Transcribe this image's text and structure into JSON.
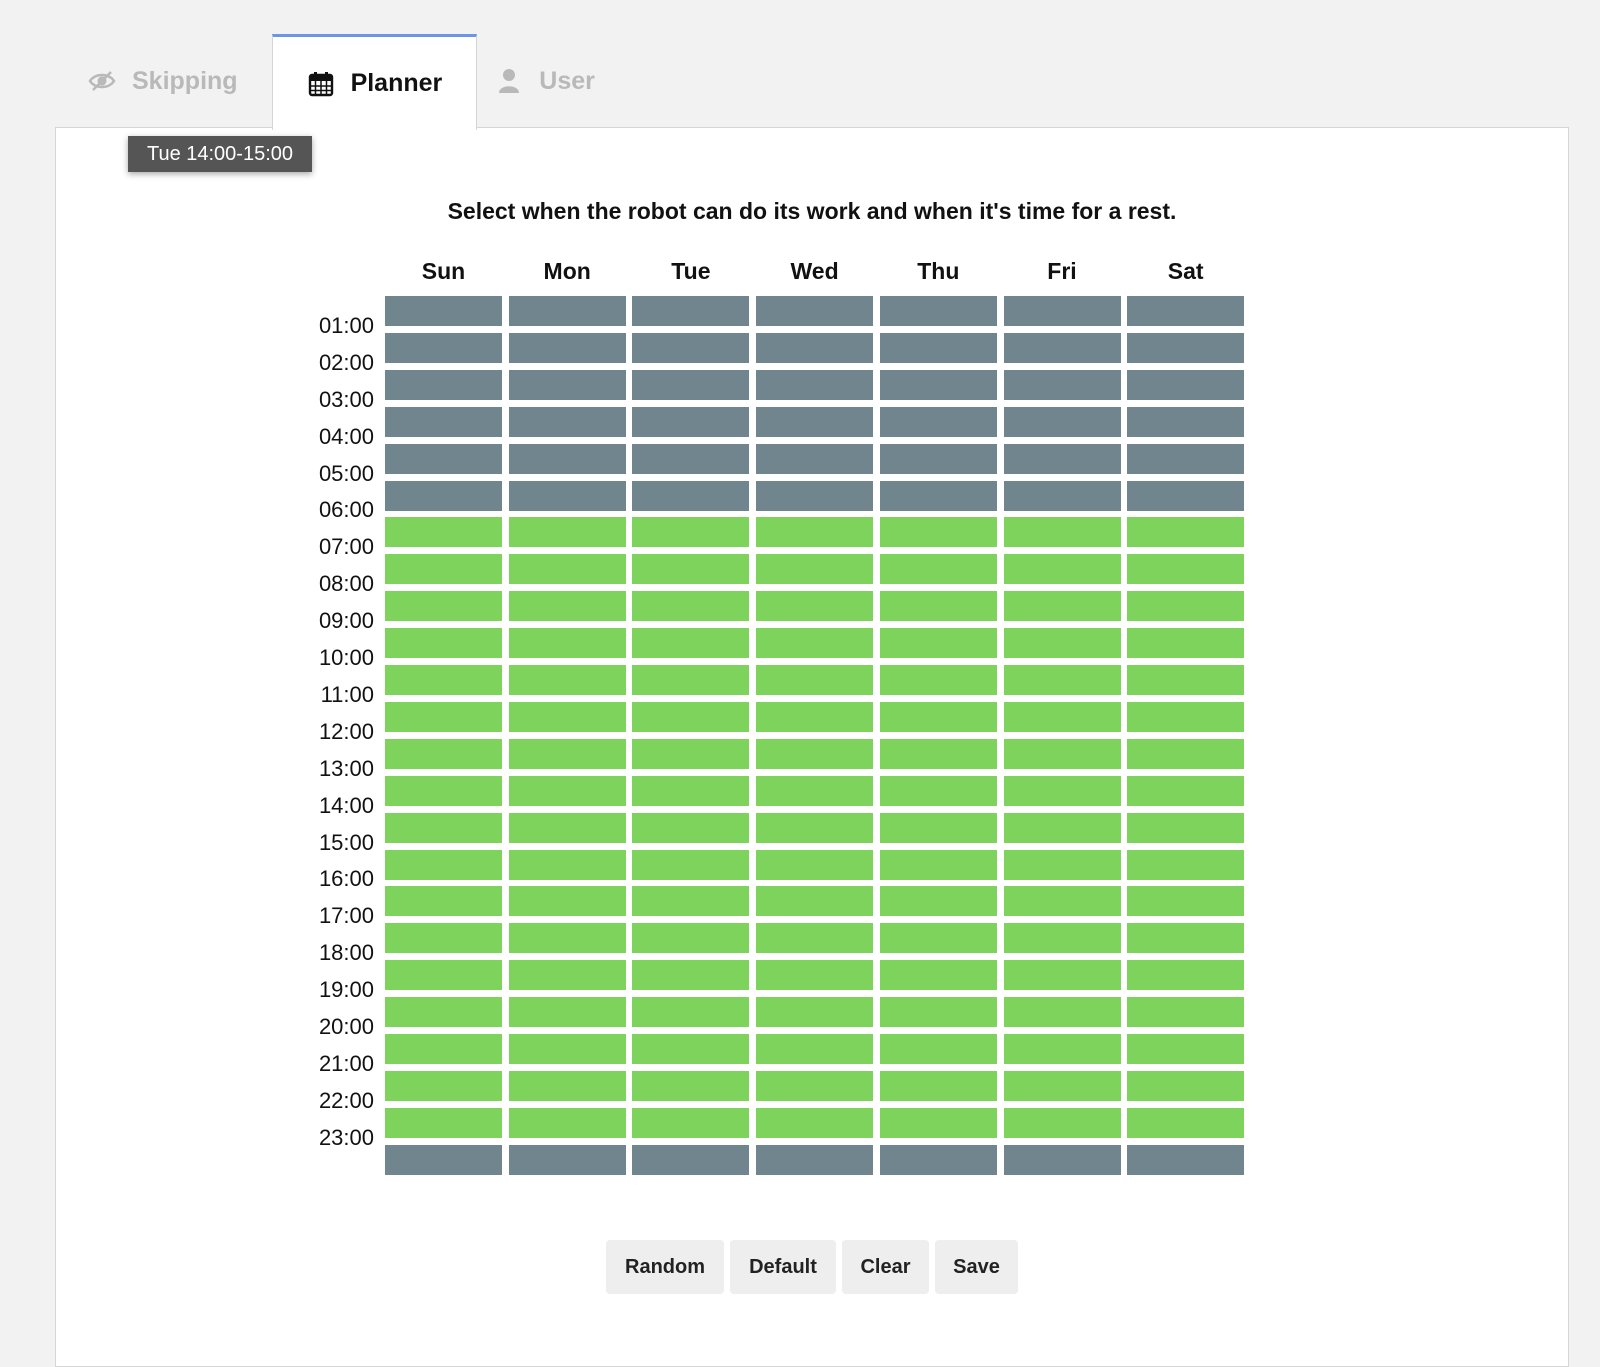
{
  "tabs": [
    {
      "label": "Skipping",
      "icon": "eye-slash-icon",
      "active": false
    },
    {
      "label": "Planner",
      "icon": "calendar-icon",
      "active": true
    },
    {
      "label": "User",
      "icon": "user-icon",
      "active": false
    }
  ],
  "tooltip": "Tue 14:00-15:00",
  "instructions": "Select when the robot can do its work and when it's time for a rest.",
  "days": [
    "Sun",
    "Mon",
    "Tue",
    "Wed",
    "Thu",
    "Fri",
    "Sat"
  ],
  "hours": [
    "01:00",
    "02:00",
    "03:00",
    "04:00",
    "05:00",
    "06:00",
    "07:00",
    "08:00",
    "09:00",
    "10:00",
    "11:00",
    "12:00",
    "13:00",
    "14:00",
    "15:00",
    "16:00",
    "17:00",
    "18:00",
    "19:00",
    "20:00",
    "21:00",
    "22:00",
    "23:00"
  ],
  "schedule": {
    "slots_per_day": 24,
    "work_slots": [
      6,
      7,
      8,
      9,
      10,
      11,
      12,
      13,
      14,
      15,
      16,
      17,
      18,
      19,
      20,
      21,
      22
    ],
    "colors": {
      "work": "#7dd35c",
      "rest": "#71858f"
    }
  },
  "buttons": {
    "random": "Random",
    "default": "Default",
    "clear": "Clear",
    "save": "Save"
  }
}
